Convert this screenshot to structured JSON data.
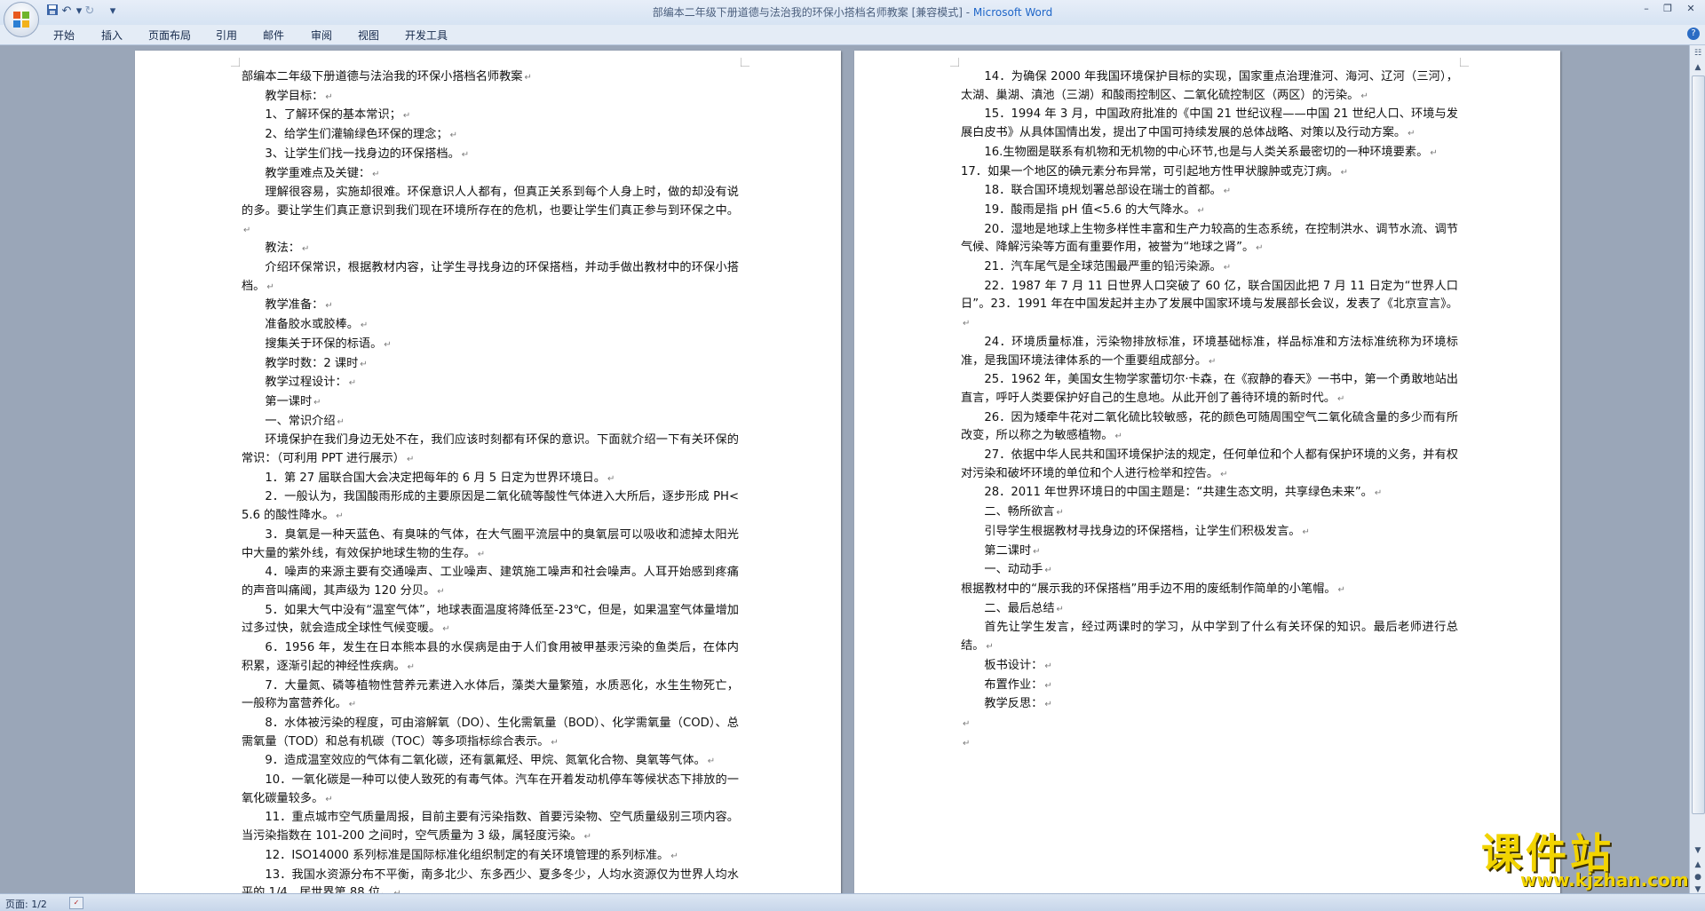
{
  "titlebar": {
    "title": "部编本二年级下册道德与法治我的环保小搭档名师教案 [兼容模式] - ",
    "app": "Microsoft Word"
  },
  "quick_access": {
    "save_icon": "save-icon",
    "undo_icon": "undo-icon",
    "redo_icon": "redo-icon",
    "customize_icon": "dropdown-icon"
  },
  "menu": [
    "开始",
    "插入",
    "页面布局",
    "引用",
    "邮件",
    "审阅",
    "视图",
    "开发工具"
  ],
  "page1": [
    {
      "t": "部编本二年级下册道德与法治我的环保小搭档名师教案",
      "i": false
    },
    {
      "t": "教学目标：",
      "i": true
    },
    {
      "t": "1、了解环保的基本常识；",
      "i": true
    },
    {
      "t": "2、给学生们灌输绿色环保的理念；",
      "i": true
    },
    {
      "t": "3、让学生们找一找身边的环保搭档。",
      "i": true
    },
    {
      "t": "教学重难点及关键：",
      "i": true
    },
    {
      "t": "理解很容易，实施却很难。环保意识人人都有，但真正关系到每个人身上时，做的却没有说的多。要让学生们真正意识到我们现在环境所存在的危机，也要让学生们真正参与到环保之中。",
      "i": true
    },
    {
      "t": "教法：",
      "i": true
    },
    {
      "t": "介绍环保常识，根据教材内容，让学生寻找身边的环保搭档，并动手做出教材中的环保小搭档。",
      "i": true
    },
    {
      "t": "教学准备：",
      "i": true
    },
    {
      "t": "准备胶水或胶棒。",
      "i": true
    },
    {
      "t": "搜集关于环保的标语。",
      "i": true
    },
    {
      "t": "教学时数：2 课时",
      "i": true
    },
    {
      "t": "教学过程设计：",
      "i": true
    },
    {
      "t": "第一课时",
      "i": true
    },
    {
      "t": "一、常识介绍",
      "i": true
    },
    {
      "t": "环境保护在我们身边无处不在，我们应该时刻都有环保的意识。下面就介绍一下有关环保的常识：（可利用 PPT 进行展示）",
      "i": true
    },
    {
      "t": "1．第 27 届联合国大会决定把每年的 6 月 5 日定为世界环境日。",
      "i": true
    },
    {
      "t": "2．一般认为，我国酸雨形成的主要原因是二氧化硫等酸性气体进入大所后，逐步形成 PH<5.6 的酸性降水。",
      "i": true
    },
    {
      "t": "3．臭氧是一种天蓝色、有臭味的气体，在大气圈平流层中的臭氧层可以吸收和滤掉太阳光中大量的紫外线，有效保护地球生物的生存。",
      "i": true
    },
    {
      "t": "4．噪声的来源主要有交通噪声、工业噪声、建筑施工噪声和社会噪声。人耳开始感到疼痛的声音叫痛阈，其声级为 120 分贝。",
      "i": true
    },
    {
      "t": "5．如果大气中没有“温室气体”，地球表面温度将降低至-23℃，但是，如果温室气体量增加过多过快，就会造成全球性气候变暖。",
      "i": true
    },
    {
      "t": "6．1956 年，发生在日本熊本县的水俣病是由于人们食用被甲基汞污染的鱼类后，在体内积累，逐渐引起的神经性疾病。",
      "i": true
    },
    {
      "t": "7．大量氮、磷等植物性营养元素进入水体后，藻类大量繁殖，水质恶化，水生生物死亡，一般称为富营养化。",
      "i": true
    },
    {
      "t": "8．水体被污染的程度，可由溶解氧（DO）、生化需氧量（BOD）、化学需氧量（COD）、总需氧量（TOD）和总有机碳（TOC）等多项指标综合表示。",
      "i": true
    },
    {
      "t": "9．造成温室效应的气体有二氧化碳，还有氯氟烃、甲烷、氮氧化合物、臭氧等气体。",
      "i": true
    },
    {
      "t": "10．一氧化碳是一种可以使人致死的有毒气体。汽车在开着发动机停车等候状态下排放的一氧化碳量较多。",
      "i": true
    },
    {
      "t": "11．重点城市空气质量周报，目前主要有污染指数、首要污染物、空气质量级别三项内容。当污染指数在 101-200 之间时，空气质量为 3 级，属轻度污染。",
      "i": true
    },
    {
      "t": "12．ISO14000 系列标准是国际标准化组织制定的有关环境管理的系列标准。",
      "i": true
    },
    {
      "t": "13．我国水资源分布不平衡，南多北少、东多西少、夏多冬少，人均水资源仅为世界人均水平的 1/4，居世界第 88 位。",
      "i": true
    }
  ],
  "page2": [
    {
      "t": "14．为确保 2000 年我国环境保护目标的实现，国家重点治理淮河、海河、辽河（三河），太湖、巢湖、滇池（三湖）和酸雨控制区、二氧化硫控制区（两区）的污染。",
      "i": true
    },
    {
      "t": "15．1994 年 3 月，中国政府批准的《中国 21 世纪议程——中国 21 世纪人口、环境与发展白皮书》从具体国情出发，提出了中国可持续发展的总体战略、对策以及行动方案。",
      "i": true
    },
    {
      "t": "16.生物圈是联系有机物和无机物的中心环节,也是与人类关系最密切的一种环境要素。",
      "i": true
    },
    {
      "t": "17．如果一个地区的碘元素分布异常，可引起地方性甲状腺肿或克汀病。",
      "i": false
    },
    {
      "t": "18．联合国环境规划署总部设在瑞士的首都。",
      "i": true
    },
    {
      "t": "19．酸雨是指 pH 值<5.6 的大气降水。",
      "i": true
    },
    {
      "t": "20．湿地是地球上生物多样性丰富和生产力较高的生态系统，在控制洪水、调节水流、调节气候、降解污染等方面有重要作用，被誉为“地球之肾”。",
      "i": true
    },
    {
      "t": "21．汽车尾气是全球范围最严重的铅污染源。",
      "i": true
    },
    {
      "t": "22．1987 年 7 月 11 日世界人口突破了 60 亿，联合国因此把 7 月 11 日定为“世界人口日”。23．1991 年在中国发起并主办了发展中国家环境与发展部长会议，发表了《北京宣言》。",
      "i": true
    },
    {
      "t": "24．环境质量标准，污染物排放标准，环境基础标准，样品标准和方法标准统称为环境标准，是我国环境法律体系的一个重要组成部分。",
      "i": true
    },
    {
      "t": "25．1962 年，美国女生物学家蕾切尔·卡森，在《寂静的春天》一书中，第一个勇敢地站出直言，呼吁人类要保护好自己的生息地。从此开创了善待环境的新时代。",
      "i": true
    },
    {
      "t": "26．因为矮牵牛花对二氧化硫比较敏感，花的颜色可随周围空气二氧化硫含量的多少而有所改变，所以称之为敏感植物。",
      "i": true
    },
    {
      "t": "27．依据中华人民共和国环境保护法的规定，任何单位和个人都有保护环境的义务，并有权对污染和破坏环境的单位和个人进行检举和控告。",
      "i": true
    },
    {
      "t": "28．2011 年世界环境日的中国主题是：“共建生态文明，共享绿色未来”。",
      "i": true
    },
    {
      "t": "二、畅所欲言",
      "i": true
    },
    {
      "t": "引导学生根据教材寻找身边的环保搭档，让学生们积极发言。",
      "i": true
    },
    {
      "t": "第二课时",
      "i": true
    },
    {
      "t": "一、动动手",
      "i": true
    },
    {
      "t": "根据教材中的“展示我的环保搭档”用手边不用的废纸制作简单的小笔帽。",
      "i": false
    },
    {
      "t": "二、最后总结",
      "i": true
    },
    {
      "t": "首先让学生发言，经过两课时的学习，从中学到了什么有关环保的知识。最后老师进行总结。",
      "i": true
    },
    {
      "t": "板书设计：",
      "i": true
    },
    {
      "t": "布置作业：",
      "i": true
    },
    {
      "t": "教学反思：",
      "i": true
    },
    {
      "t": "",
      "i": false
    },
    {
      "t": "",
      "i": false
    }
  ],
  "status": {
    "page": "页面: 1/2"
  },
  "watermark": {
    "main": "课件站",
    "url": "www.kjzhan.com"
  },
  "colors": {
    "title_app": "#1f66c8",
    "watermark": "#f2d400",
    "workspace": "#9aa6b8"
  }
}
